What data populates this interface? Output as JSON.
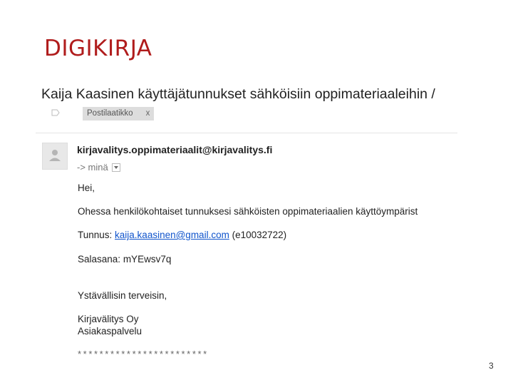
{
  "slide": {
    "title": "DIGIKIRJA",
    "page_number": "3"
  },
  "email": {
    "subject": "Kaija Kaasinen käyttäjätunnukset sähköisiin oppimateriaaleihin /",
    "label": "Postilaatikko",
    "label_remove": "x",
    "sender": "kirjavalitys.oppimateriaalit@kirjavalitys.fi",
    "recipient": "-> minä",
    "greeting": "Hei,",
    "intro": "Ohessa henkilökohtaiset tunnuksesi sähköisten oppimateriaalien käyttöympärist",
    "username_label": "Tunnus:",
    "username_email": "kaija.kaasinen@gmail.com",
    "username_id": "(e10032722)",
    "password_label": "Salasana:",
    "password_value": "mYEwsv7q",
    "closing": "Ystävällisin terveisin,",
    "company": "Kirjavälitys Oy",
    "department": "Asiakaspalvelu",
    "separator": "************************"
  },
  "colors": {
    "title": "#b01c1c",
    "link": "#1155cc",
    "label_chip_bg": "#dddddd"
  },
  "icons": {
    "label": "label-tag-icon",
    "avatar": "person-silhouette-icon",
    "dropdown": "chevron-down-icon"
  }
}
